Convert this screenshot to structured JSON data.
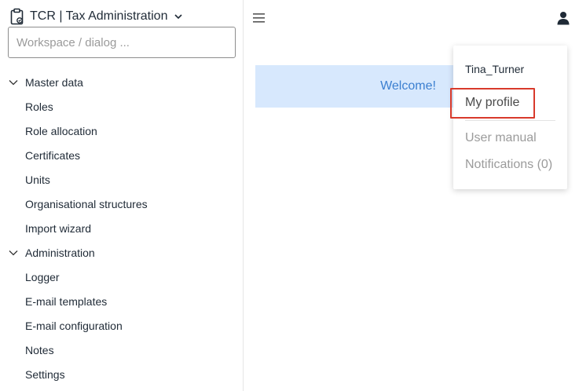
{
  "app": {
    "title": "TCR | Tax Administration"
  },
  "search": {
    "placeholder": "Workspace / dialog ..."
  },
  "sidebar": {
    "groups": [
      {
        "label": "Master data",
        "items": [
          "Roles",
          "Role allocation",
          "Certificates",
          "Units",
          "Organisational structures",
          "Import wizard"
        ]
      },
      {
        "label": "Administration",
        "items": [
          "Logger",
          "E-mail templates",
          "E-mail configuration",
          "Notes",
          "Settings"
        ]
      }
    ]
  },
  "main": {
    "welcome": "Welcome!"
  },
  "user_menu": {
    "username": "Tina_Turner",
    "my_profile": "My profile",
    "user_manual": "User manual",
    "notifications": "Notifications (0)"
  },
  "colors": {
    "welcome_bg": "#d7e8fd",
    "welcome_text": "#3b7fd0",
    "highlight_border": "#d83a2b"
  }
}
